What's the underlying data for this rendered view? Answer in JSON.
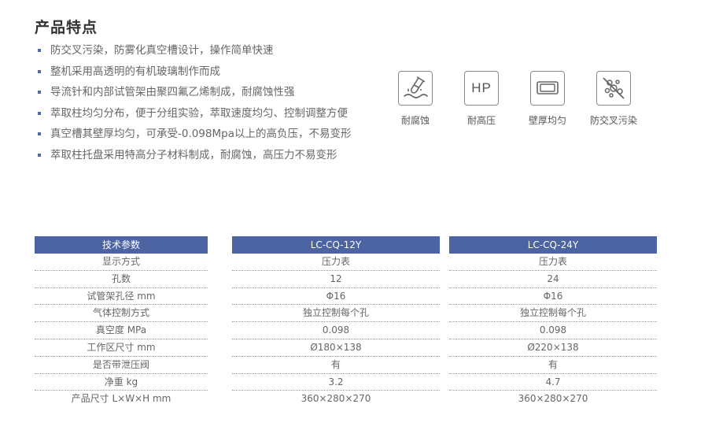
{
  "title": "产品特点",
  "features": [
    "防交叉污染，防雾化真空槽设计，操作简单快速",
    "整机采用高透明的有机玻璃制作而成",
    "导流针和内部试管架由聚四氟乙烯制成，耐腐蚀性强",
    "萃取柱均匀分布，便于分组实验，萃取速度均匀、控制调整方便",
    "真空槽其壁厚均匀，可承受-0.098Mpa以上的高负压，不易变形",
    "萃取柱托盘采用特高分子材料制成，耐腐蚀，高压力不易变形"
  ],
  "icons": [
    {
      "name": "corrosion-resistant-icon",
      "label": "耐腐蚀"
    },
    {
      "name": "high-pressure-icon",
      "label": "耐高压",
      "text": "HP"
    },
    {
      "name": "uniform-wall-icon",
      "label": "壁厚均匀"
    },
    {
      "name": "anti-cross-contamination-icon",
      "label": "防交叉污染"
    }
  ],
  "table": {
    "headers": [
      "技术参数",
      "LC-CQ-12Y",
      "LC-CQ-24Y"
    ],
    "params": [
      "显示方式",
      "孔数",
      "试管架孔径 mm",
      "气体控制方式",
      "真空度 MPa",
      "工作区尺寸 mm",
      "是否带泄压阀",
      "净重 kg",
      "产品尺寸 L×W×H mm"
    ],
    "model_12y": [
      "压力表",
      "12",
      "Φ16",
      "独立控制每个孔",
      "0.098",
      "Ø180×138",
      "有",
      "3.2",
      "360×280×270"
    ],
    "model_24y": [
      "压力表",
      "24",
      "Φ16",
      "独立控制每个孔",
      "0.098",
      "Ø220×138",
      "有",
      "4.7",
      "360×280×270"
    ]
  },
  "colors": {
    "accent": "#4c64a2",
    "bullet": "#5068a5"
  }
}
